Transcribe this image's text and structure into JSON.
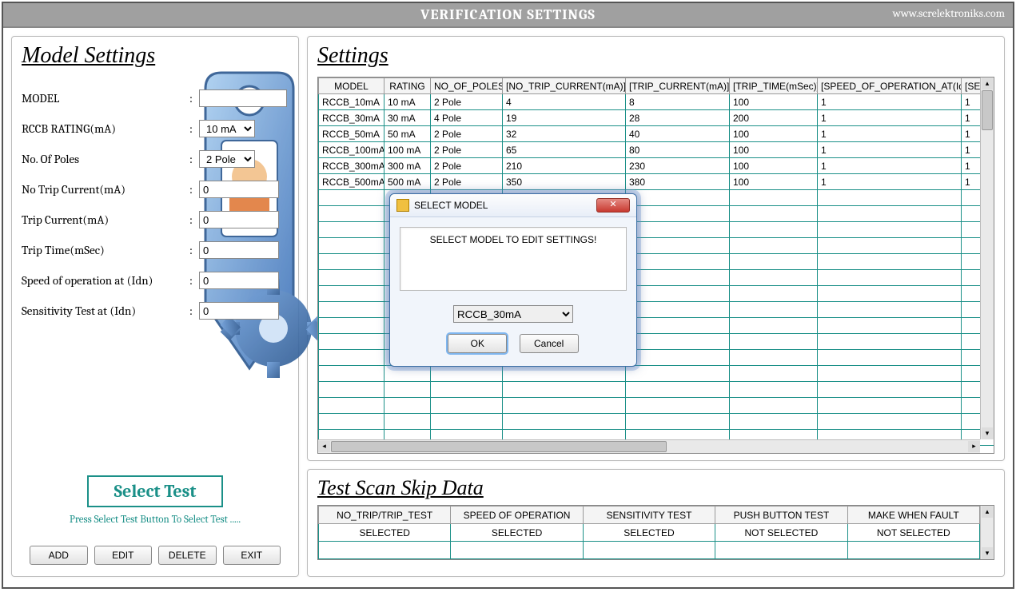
{
  "header": {
    "title": "VERIFICATION SETTINGS",
    "url": "www.screlektroniks.com"
  },
  "left": {
    "section_title": "Model Settings",
    "fields": {
      "model_label": "MODEL",
      "model_value": "",
      "rating_label": "RCCB RATING(mA)",
      "rating_value": "10 mA",
      "poles_label": "No. Of Poles",
      "poles_value": "2 Pole",
      "notrip_label": "No Trip Current(mA)",
      "notrip_value": "0",
      "trip_label": "Trip Current(mA)",
      "trip_value": "0",
      "triptime_label": "Trip Time(mSec)",
      "triptime_value": "0",
      "speed_label": "Speed of operation at (Idn)",
      "speed_value": "0",
      "sens_label": "Sensitivity Test at (Idn)",
      "sens_value": "0"
    },
    "select_test_label": "Select Test",
    "hint": "Press Select Test Button To Select Test .....",
    "buttons": {
      "add": "ADD",
      "edit": "EDIT",
      "delete": "DELETE",
      "exit": "EXIT"
    }
  },
  "settings": {
    "section_title": "Settings",
    "columns": [
      "MODEL",
      "RATING",
      "NO_OF_POLES",
      "[NO_TRIP_CURRENT(mA)]",
      "[TRIP_CURRENT(mA)]",
      "[TRIP_TIME(mSec)]",
      "[SPEED_OF_OPERATION_AT(Idn)]",
      "[SENSI"
    ],
    "rows": [
      [
        "RCCB_10mA",
        "10 mA",
        "2 Pole",
        "4",
        "8",
        "100",
        "1",
        "1"
      ],
      [
        "RCCB_30mA",
        "30 mA",
        "4 Pole",
        "19",
        "28",
        "200",
        "1",
        "1"
      ],
      [
        "RCCB_50mA",
        "50 mA",
        "2 Pole",
        "32",
        "40",
        "100",
        "1",
        "1"
      ],
      [
        "RCCB_100mA",
        "100 mA",
        "2 Pole",
        "65",
        "80",
        "100",
        "1",
        "1"
      ],
      [
        "RCCB_300mA",
        "300 mA",
        "2 Pole",
        "210",
        "230",
        "100",
        "1",
        "1"
      ],
      [
        "RCCB_500mA",
        "500 mA",
        "2 Pole",
        "350",
        "380",
        "100",
        "1",
        "1"
      ]
    ]
  },
  "skip": {
    "section_title": "Test Scan Skip Data",
    "columns": [
      "NO_TRIP/TRIP_TEST",
      "SPEED OF OPERATION",
      "SENSITIVITY TEST",
      "PUSH BUTTON TEST",
      "MAKE WHEN FAULT"
    ],
    "row": [
      "SELECTED",
      "SELECTED",
      "SELECTED",
      "NOT SELECTED",
      "NOT SELECTED"
    ]
  },
  "modal": {
    "title": "SELECT MODEL",
    "message": "SELECT MODEL TO EDIT SETTINGS!",
    "selected": "RCCB_30mA",
    "ok": "OK",
    "cancel": "Cancel"
  }
}
